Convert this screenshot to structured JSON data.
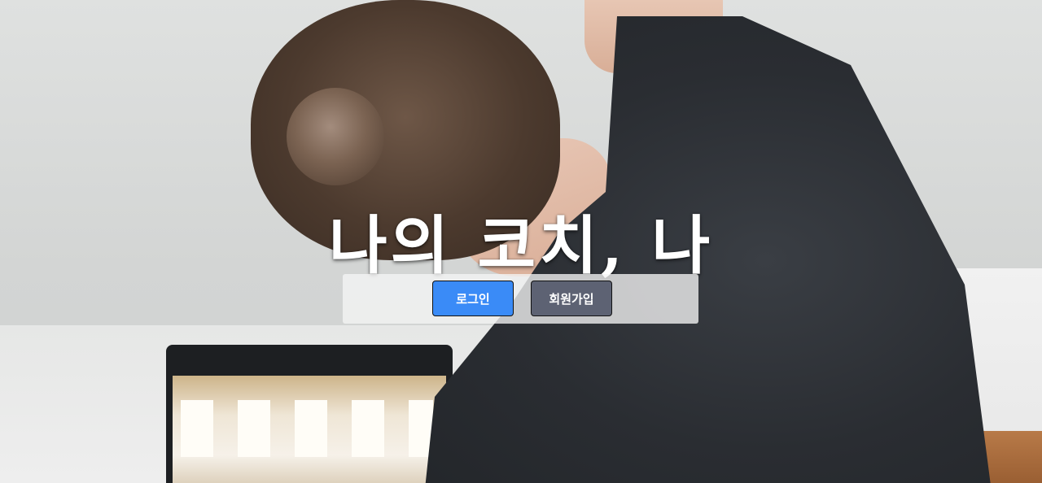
{
  "hero": {
    "title": "나의 코치, 나"
  },
  "auth": {
    "login_label": "로그인",
    "signup_label": "회원가입",
    "login_color": "#3a8bf7",
    "signup_color": "#5d6273"
  },
  "background": {
    "description_icon": "photo-woman-stretching-icon"
  }
}
